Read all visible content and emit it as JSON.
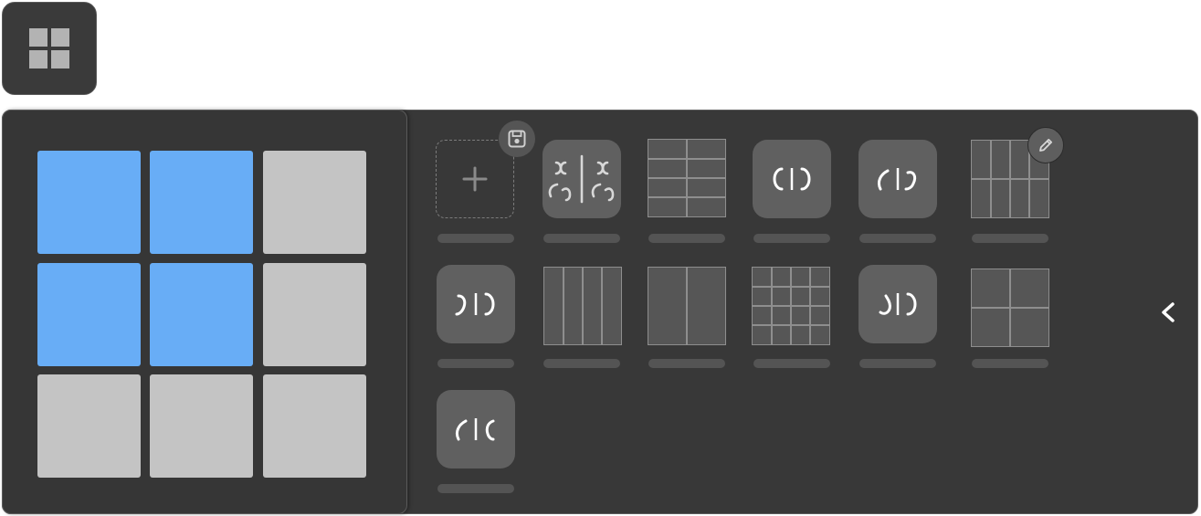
{
  "toggle_button": {
    "icon": "grid-2x2-icon"
  },
  "selector_grid": {
    "rows": 3,
    "cols": 3,
    "selected_rows": 2,
    "selected_cols": 2,
    "colors": {
      "selected": "#68adf6",
      "unselected": "#c4c4c4"
    }
  },
  "presets": {
    "save_badge_icon": "save-icon",
    "edit_badge_icon": "pencil-icon",
    "items": [
      {
        "id": "add-custom",
        "icon": "plus-icon"
      },
      {
        "id": "four-view",
        "icon": "four-view-icon"
      },
      {
        "id": "grid-2x4",
        "icon": "grid-2col-4row-icon"
      },
      {
        "id": "two-view",
        "icon": "two-view-icon"
      },
      {
        "id": "split-a",
        "icon": "split-view-icon"
      },
      {
        "id": "grid-4x2",
        "icon": "grid-4col-2row-icon"
      },
      {
        "id": "split-b",
        "icon": "split-view-icon"
      },
      {
        "id": "grid-4x1",
        "icon": "grid-4col-icon"
      },
      {
        "id": "grid-2x1",
        "icon": "grid-2col-icon"
      },
      {
        "id": "grid-4x4",
        "icon": "grid-4col-4row-icon"
      },
      {
        "id": "split-c",
        "icon": "split-view-icon"
      },
      {
        "id": "grid-2x2",
        "icon": "grid-2col-2row-icon"
      },
      {
        "id": "split-d",
        "icon": "split-view-icon"
      }
    ]
  },
  "collapse_button": {
    "icon": "chevron-left-icon"
  }
}
